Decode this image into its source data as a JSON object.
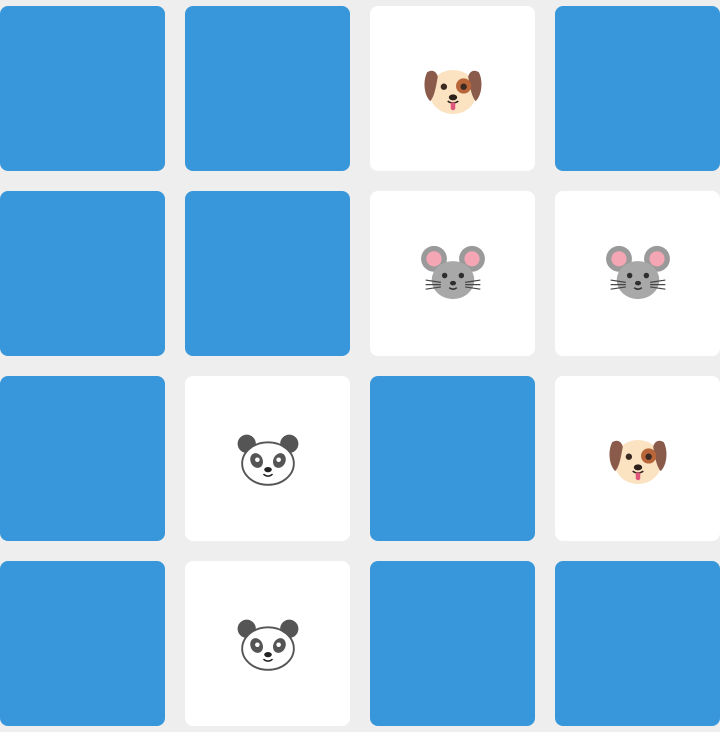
{
  "game": {
    "type": "memory-match",
    "colors": {
      "background": "#eeeeee",
      "card_back": "#3897db",
      "card_face": "#ffffff"
    },
    "grid": {
      "rows": 4,
      "cols": 4
    },
    "cards": [
      {
        "state": "face-down",
        "symbol": null
      },
      {
        "state": "face-down",
        "symbol": null
      },
      {
        "state": "face-up",
        "symbol": "dog-face-icon"
      },
      {
        "state": "face-down",
        "symbol": null
      },
      {
        "state": "face-down",
        "symbol": null
      },
      {
        "state": "face-down",
        "symbol": null
      },
      {
        "state": "face-up",
        "symbol": "mouse-face-icon"
      },
      {
        "state": "face-up",
        "symbol": "mouse-face-icon"
      },
      {
        "state": "face-down",
        "symbol": null
      },
      {
        "state": "face-up",
        "symbol": "panda-face-icon"
      },
      {
        "state": "face-down",
        "symbol": null
      },
      {
        "state": "face-up",
        "symbol": "dog-face-icon"
      },
      {
        "state": "face-down",
        "symbol": null
      },
      {
        "state": "face-up",
        "symbol": "panda-face-icon"
      },
      {
        "state": "face-down",
        "symbol": null
      },
      {
        "state": "face-down",
        "symbol": null
      }
    ]
  }
}
